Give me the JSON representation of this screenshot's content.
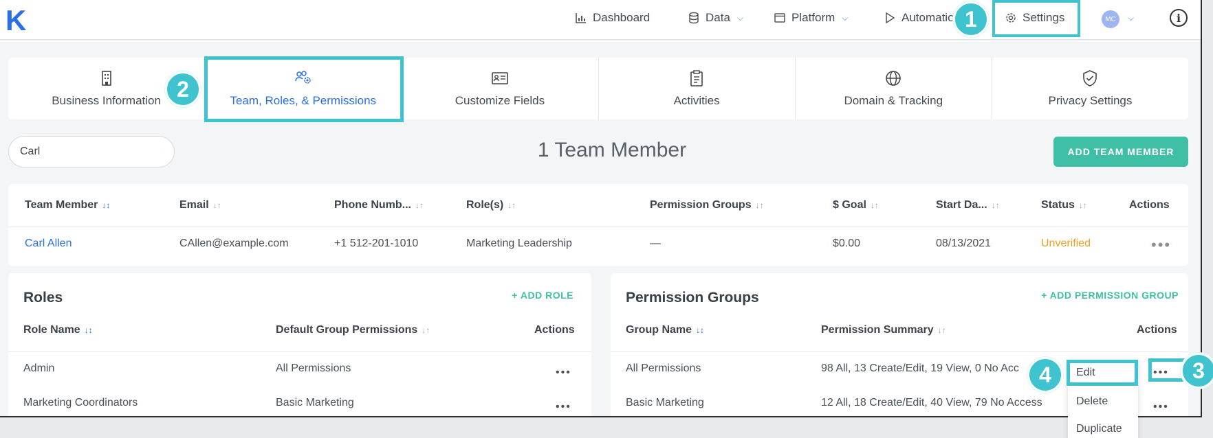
{
  "app": {
    "logo": "K"
  },
  "nav": {
    "dashboard": "Dashboard",
    "data": "Data",
    "platform": "Platform",
    "automations": "Automatio",
    "settings": "Settings",
    "avatar": "MC"
  },
  "callouts": [
    "1",
    "2",
    "3",
    "4"
  ],
  "tabs": [
    {
      "label": "Business Information",
      "icon": "building-icon"
    },
    {
      "label": "Team, Roles, & Permissions",
      "icon": "team-settings-icon"
    },
    {
      "label": "Customize Fields",
      "icon": "id-card-icon"
    },
    {
      "label": "Activities",
      "icon": "clipboard-icon"
    },
    {
      "label": "Domain & Tracking",
      "icon": "globe-icon"
    },
    {
      "label": "Privacy Settings",
      "icon": "shield-check-icon"
    }
  ],
  "search": {
    "value": "Carl"
  },
  "team": {
    "count_title": "1 Team Member",
    "add_button": "ADD TEAM MEMBER",
    "columns": [
      "Team Member",
      "Email",
      "Phone Numb...",
      "Role(s)",
      "Permission Groups",
      "$ Goal",
      "Start Da...",
      "Status",
      "Actions"
    ],
    "rows": [
      {
        "name": "Carl Allen",
        "email": "CAllen@example.com",
        "phone": "+1 512-201-1010",
        "role": "Marketing Leadership",
        "permission_groups": "—",
        "goal": "$0.00",
        "start_date": "08/13/2021",
        "status": "Unverified",
        "actions": "•••"
      }
    ]
  },
  "roles": {
    "title": "Roles",
    "add_link": "+ ADD ROLE",
    "columns": [
      "Role Name",
      "Default Group Permissions",
      "Actions"
    ],
    "rows": [
      {
        "name": "Admin",
        "default": "All Permissions",
        "actions": "•••"
      },
      {
        "name": "Marketing Coordinators",
        "default": "Basic Marketing",
        "actions": "•••"
      }
    ]
  },
  "permission_groups": {
    "title": "Permission Groups",
    "add_link": "+ ADD PERMISSION GROUP",
    "columns": [
      "Group Name",
      "Permission Summary",
      "Actions"
    ],
    "rows": [
      {
        "name": "All Permissions",
        "summary": "98 All, 13 Create/Edit, 19 View, 0 No Acc",
        "actions": "•••"
      },
      {
        "name": "Basic Marketing",
        "summary": "12 All, 18 Create/Edit, 40 View, 79 No Access",
        "actions": "•••"
      }
    ]
  },
  "dropdown": {
    "items": [
      "Edit",
      "Delete",
      "Duplicate"
    ]
  },
  "colors": {
    "accent": "#2a6fe6",
    "teal": "#3fc4cf",
    "green": "#3fbfa6",
    "warning": "#f0a020"
  }
}
